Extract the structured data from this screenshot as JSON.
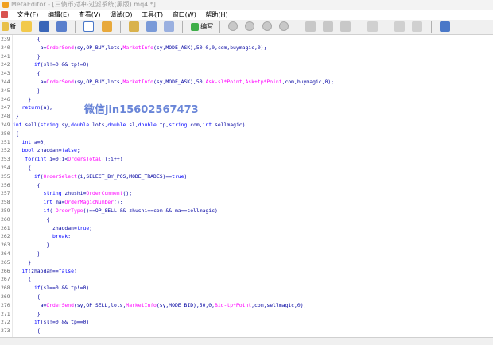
{
  "window": {
    "title": "MetaEditor - [三债币对冲-过滤系统(黑版).mq4 *]"
  },
  "menu": [
    "文件(F)",
    "编辑(E)",
    "查看(V)",
    "调试(D)",
    "工具(T)",
    "窗口(W)",
    "帮助(H)"
  ],
  "toolbar": {
    "new_label": "新",
    "compile_label": "编写"
  },
  "watermark": "微信jin15602567473",
  "code_lines": [
    {
      "n": "239",
      "segs": [
        {
          "t": "        {",
          "c": "d"
        }
      ]
    },
    {
      "n": "240",
      "segs": [
        {
          "t": "         a=",
          "c": "d"
        },
        {
          "t": "OrderSend",
          "c": "f"
        },
        {
          "t": "(sy,OP_BUY,lots,",
          "c": "d"
        },
        {
          "t": "MarketInfo",
          "c": "f"
        },
        {
          "t": "(sy,MODE_ASK),50,0,0,com,buymagic,0);",
          "c": "d"
        }
      ]
    },
    {
      "n": "241",
      "segs": [
        {
          "t": "        }",
          "c": "d"
        }
      ]
    },
    {
      "n": "242",
      "segs": [
        {
          "t": "       ",
          "c": "d"
        },
        {
          "t": "if",
          "c": "k"
        },
        {
          "t": "(sl!=0 && tp!=0)",
          "c": "d"
        }
      ]
    },
    {
      "n": "243",
      "segs": [
        {
          "t": "        {",
          "c": "d"
        }
      ]
    },
    {
      "n": "244",
      "segs": [
        {
          "t": "         a=",
          "c": "d"
        },
        {
          "t": "OrderSend",
          "c": "f"
        },
        {
          "t": "(sy,OP_BUY,lots,",
          "c": "d"
        },
        {
          "t": "MarketInfo",
          "c": "f"
        },
        {
          "t": "(sy,MODE_ASK),50,",
          "c": "d"
        },
        {
          "t": "Ask-sl*Point,Ask+tp*Point",
          "c": "f"
        },
        {
          "t": ",com,buymagic,0);",
          "c": "d"
        }
      ]
    },
    {
      "n": "245",
      "segs": [
        {
          "t": "        }",
          "c": "d"
        }
      ]
    },
    {
      "n": "246",
      "segs": [
        {
          "t": "     }",
          "c": "d"
        }
      ]
    },
    {
      "n": "247",
      "segs": [
        {
          "t": "   ",
          "c": "d"
        },
        {
          "t": "return",
          "c": "k"
        },
        {
          "t": "(a);",
          "c": "d"
        }
      ]
    },
    {
      "n": "248",
      "segs": [
        {
          "t": " }",
          "c": "d"
        }
      ]
    },
    {
      "n": "249",
      "segs": [
        {
          "t": "int",
          "c": "k"
        },
        {
          "t": " sell(",
          "c": "d"
        },
        {
          "t": "string",
          "c": "k"
        },
        {
          "t": " sy,",
          "c": "d"
        },
        {
          "t": "double",
          "c": "k"
        },
        {
          "t": " lots,",
          "c": "d"
        },
        {
          "t": "double",
          "c": "k"
        },
        {
          "t": " sl,",
          "c": "d"
        },
        {
          "t": "double",
          "c": "k"
        },
        {
          "t": " tp,",
          "c": "d"
        },
        {
          "t": "string",
          "c": "k"
        },
        {
          "t": " com,",
          "c": "d"
        },
        {
          "t": "int",
          "c": "k"
        },
        {
          "t": " sellmagic)",
          "c": "d"
        }
      ]
    },
    {
      "n": "250",
      "segs": [
        {
          "t": " {",
          "c": "d"
        }
      ]
    },
    {
      "n": "251",
      "segs": [
        {
          "t": "   ",
          "c": "d"
        },
        {
          "t": "int",
          "c": "k"
        },
        {
          "t": " a=0;",
          "c": "d"
        }
      ]
    },
    {
      "n": "252",
      "segs": [
        {
          "t": "   ",
          "c": "d"
        },
        {
          "t": "bool",
          "c": "k"
        },
        {
          "t": " zhaodan=",
          "c": "d"
        },
        {
          "t": "false",
          "c": "k"
        },
        {
          "t": ";",
          "c": "d"
        }
      ]
    },
    {
      "n": "253",
      "segs": [
        {
          "t": "    ",
          "c": "d"
        },
        {
          "t": "for",
          "c": "k"
        },
        {
          "t": "(",
          "c": "d"
        },
        {
          "t": "int",
          "c": "k"
        },
        {
          "t": " i=0;i<",
          "c": "d"
        },
        {
          "t": "OrdersTotal",
          "c": "f"
        },
        {
          "t": "();i++)",
          "c": "d"
        }
      ]
    },
    {
      "n": "254",
      "segs": [
        {
          "t": "     {",
          "c": "d"
        }
      ]
    },
    {
      "n": "255",
      "segs": [
        {
          "t": "       ",
          "c": "d"
        },
        {
          "t": "if",
          "c": "k"
        },
        {
          "t": "(",
          "c": "d"
        },
        {
          "t": "OrderSelect",
          "c": "f"
        },
        {
          "t": "(i,SELECT_BY_POS,MODE_TRADES)==",
          "c": "d"
        },
        {
          "t": "true",
          "c": "k"
        },
        {
          "t": ")",
          "c": "d"
        }
      ]
    },
    {
      "n": "256",
      "segs": [
        {
          "t": "        {",
          "c": "d"
        }
      ]
    },
    {
      "n": "257",
      "segs": [
        {
          "t": "          ",
          "c": "d"
        },
        {
          "t": "string",
          "c": "k"
        },
        {
          "t": " zhushi=",
          "c": "d"
        },
        {
          "t": "OrderComment",
          "c": "f"
        },
        {
          "t": "();",
          "c": "d"
        }
      ]
    },
    {
      "n": "258",
      "segs": [
        {
          "t": "          ",
          "c": "d"
        },
        {
          "t": "int",
          "c": "k"
        },
        {
          "t": " ma=",
          "c": "d"
        },
        {
          "t": "OrderMagicNumber",
          "c": "f"
        },
        {
          "t": "();",
          "c": "d"
        }
      ]
    },
    {
      "n": "259",
      "segs": [
        {
          "t": "          ",
          "c": "d"
        },
        {
          "t": "if",
          "c": "k"
        },
        {
          "t": "( ",
          "c": "d"
        },
        {
          "t": "OrderType",
          "c": "f"
        },
        {
          "t": "()==OP_SELL && zhushi==com && ma==sellmagic)",
          "c": "d"
        }
      ]
    },
    {
      "n": "260",
      "segs": [
        {
          "t": "           {",
          "c": "d"
        }
      ]
    },
    {
      "n": "261",
      "segs": [
        {
          "t": "             zhaodan=",
          "c": "d"
        },
        {
          "t": "true",
          "c": "k"
        },
        {
          "t": ";",
          "c": "d"
        }
      ]
    },
    {
      "n": "262",
      "segs": [
        {
          "t": "             ",
          "c": "d"
        },
        {
          "t": "break",
          "c": "k"
        },
        {
          "t": ";",
          "c": "d"
        }
      ]
    },
    {
      "n": "263",
      "segs": [
        {
          "t": "           }",
          "c": "d"
        }
      ]
    },
    {
      "n": "264",
      "segs": [
        {
          "t": "        }",
          "c": "d"
        }
      ]
    },
    {
      "n": "265",
      "segs": [
        {
          "t": "     }",
          "c": "d"
        }
      ]
    },
    {
      "n": "266",
      "segs": [
        {
          "t": "   ",
          "c": "d"
        },
        {
          "t": "if",
          "c": "k"
        },
        {
          "t": "(zhaodan==",
          "c": "d"
        },
        {
          "t": "false",
          "c": "k"
        },
        {
          "t": ")",
          "c": "d"
        }
      ]
    },
    {
      "n": "267",
      "segs": [
        {
          "t": "     {",
          "c": "d"
        }
      ]
    },
    {
      "n": "268",
      "segs": [
        {
          "t": "       ",
          "c": "d"
        },
        {
          "t": "if",
          "c": "k"
        },
        {
          "t": "(sl==0 && tp!=0)",
          "c": "d"
        }
      ]
    },
    {
      "n": "269",
      "segs": [
        {
          "t": "        {",
          "c": "d"
        }
      ]
    },
    {
      "n": "270",
      "segs": [
        {
          "t": "         a=",
          "c": "d"
        },
        {
          "t": "OrderSend",
          "c": "f"
        },
        {
          "t": "(sy,OP_SELL,lots,",
          "c": "d"
        },
        {
          "t": "MarketInfo",
          "c": "f"
        },
        {
          "t": "(sy,MODE_BID),50,0,",
          "c": "d"
        },
        {
          "t": "Bid-tp*Point",
          "c": "f"
        },
        {
          "t": ",com,sellmagic,0);",
          "c": "d"
        }
      ]
    },
    {
      "n": "271",
      "segs": [
        {
          "t": "        }",
          "c": "d"
        }
      ]
    },
    {
      "n": "272",
      "segs": [
        {
          "t": "       ",
          "c": "d"
        },
        {
          "t": "if",
          "c": "k"
        },
        {
          "t": "(sl!=0 && tp==0)",
          "c": "d"
        }
      ]
    },
    {
      "n": "273",
      "segs": [
        {
          "t": "        {",
          "c": "d"
        }
      ]
    },
    {
      "n": "274",
      "segs": [
        {
          "t": "         a=",
          "c": "d"
        },
        {
          "t": "OrderSend",
          "c": "f"
        },
        {
          "t": "(sy,OP_SELL,lots,",
          "c": "d"
        },
        {
          "t": "MarketInfo",
          "c": "f"
        },
        {
          "t": "(sy,MODE_BID),50,",
          "c": "d"
        },
        {
          "t": "Bid+sl*Point",
          "c": "f"
        },
        {
          "t": ",0,com,sellmagic,0);",
          "c": "d"
        }
      ]
    },
    {
      "n": "275",
      "segs": [
        {
          "t": "        }",
          "c": "d"
        }
      ]
    },
    {
      "n": "276",
      "segs": [
        {
          "t": "       ",
          "c": "d"
        },
        {
          "t": "if",
          "c": "k"
        },
        {
          "t": "(sl==0 && tp==0)",
          "c": "d"
        }
      ]
    }
  ]
}
